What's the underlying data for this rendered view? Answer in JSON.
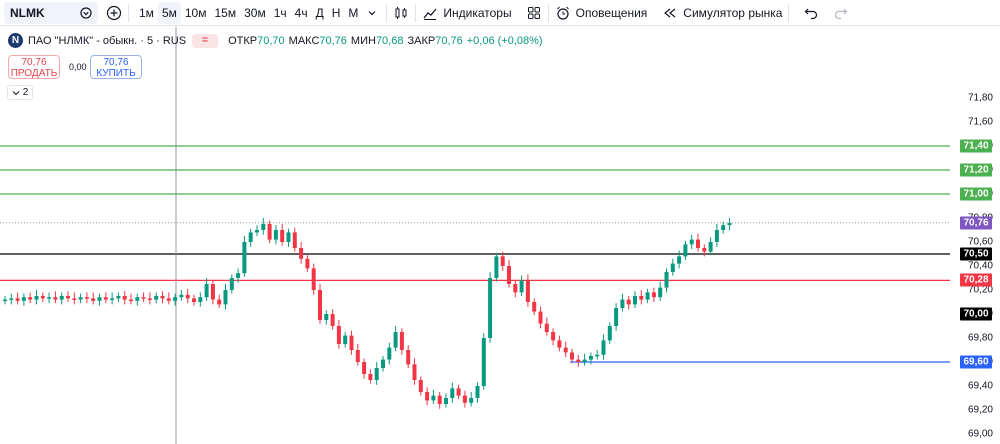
{
  "toolbar": {
    "symbol": "NLMK",
    "intervals": [
      "1м",
      "5м",
      "10м",
      "15м",
      "30м",
      "1ч",
      "4ч",
      "Д",
      "Н",
      "М"
    ],
    "active_interval": "5м",
    "indicators_label": "Индикаторы",
    "alerts_label": "Оповещения",
    "replay_label": "Симулятор рынка"
  },
  "legend": {
    "logo_letter": "N",
    "title": "ПАО \"НЛМК\" - обыкн. · 5 · RUS",
    "badge": "=",
    "open_label": "ОТКР",
    "open": "70,70",
    "high_label": "МАКС",
    "high": "70,76",
    "low_label": "МИН",
    "low": "70,68",
    "close_label": "ЗАКР",
    "close": "70,76",
    "change": "+0,06 (+0,08%)"
  },
  "trade": {
    "sell_price": "70,76",
    "sell_label": "ПРОДАТЬ",
    "spread": "0,00",
    "buy_price": "70,76",
    "buy_label": "КУПИТЬ",
    "collapse_count": "2"
  },
  "price_scale": {
    "labels": [
      "71,80",
      "71,60",
      "71,40",
      "71,20",
      "71,00",
      "70,80",
      "70,60",
      "70,40",
      "70,20",
      "70,00",
      "69,80",
      "69,60",
      "69,40",
      "69,20",
      "69,00"
    ],
    "tags": [
      {
        "value": "71,40",
        "color": "#4caf50"
      },
      {
        "value": "71,20",
        "color": "#4caf50"
      },
      {
        "value": "71,00",
        "color": "#4caf50"
      },
      {
        "value": "70,76",
        "color": "#7e57c2"
      },
      {
        "value": "70,50",
        "color": "#000000"
      },
      {
        "value": "70,28",
        "color": "#f23645"
      },
      {
        "value": "70,00",
        "color": "#000000"
      },
      {
        "value": "69,60",
        "color": "#2962ff"
      }
    ]
  },
  "colors": {
    "up": "#089981",
    "down": "#f23645",
    "green_level": "#4caf50",
    "red_level": "#f23645",
    "blue_level": "#2962ff",
    "black_level": "#000000"
  },
  "chart_data": {
    "type": "candlestick",
    "ylim": [
      69.0,
      71.9
    ],
    "levels": [
      {
        "price": 71.4,
        "color": "#4caf50"
      },
      {
        "price": 71.2,
        "color": "#4caf50"
      },
      {
        "price": 71.0,
        "color": "#4caf50"
      },
      {
        "price": 70.5,
        "color": "#000000"
      },
      {
        "price": 70.28,
        "color": "#f23645"
      },
      {
        "price": 69.6,
        "color": "#2962ff",
        "from_index": 90
      }
    ],
    "last_price": 70.76,
    "prices": [
      70.12,
      70.13,
      70.11,
      70.14,
      70.12,
      70.15,
      70.13,
      70.14,
      70.12,
      70.15,
      70.13,
      70.12,
      70.14,
      70.13,
      70.11,
      70.14,
      70.12,
      70.13,
      70.15,
      70.12,
      70.11,
      70.14,
      70.13,
      70.12,
      70.15,
      70.13,
      70.11,
      70.14,
      70.16,
      70.13,
      70.1,
      70.14,
      70.25,
      70.12,
      70.08,
      70.2,
      70.3,
      70.34,
      70.6,
      70.68,
      70.7,
      70.75,
      70.62,
      70.7,
      70.6,
      70.68,
      70.55,
      70.46,
      70.38,
      70.2,
      69.95,
      70.0,
      69.9,
      69.75,
      69.82,
      69.7,
      69.6,
      69.5,
      69.45,
      69.55,
      69.62,
      69.72,
      69.85,
      69.7,
      69.58,
      69.45,
      69.35,
      69.28,
      69.32,
      69.25,
      69.3,
      69.38,
      69.32,
      69.26,
      69.3,
      69.4,
      69.8,
      70.3,
      70.48,
      70.4,
      70.25,
      70.18,
      70.28,
      70.1,
      70.02,
      69.92,
      69.85,
      69.78,
      69.72,
      69.68,
      69.62,
      69.6,
      69.62,
      69.65,
      69.66,
      69.78,
      69.9,
      70.05,
      70.12,
      70.08,
      70.15,
      70.12,
      70.18,
      70.14,
      70.22,
      70.35,
      70.42,
      70.48,
      70.58,
      70.62,
      70.55,
      70.52,
      70.6,
      70.7,
      70.74,
      70.76
    ]
  }
}
